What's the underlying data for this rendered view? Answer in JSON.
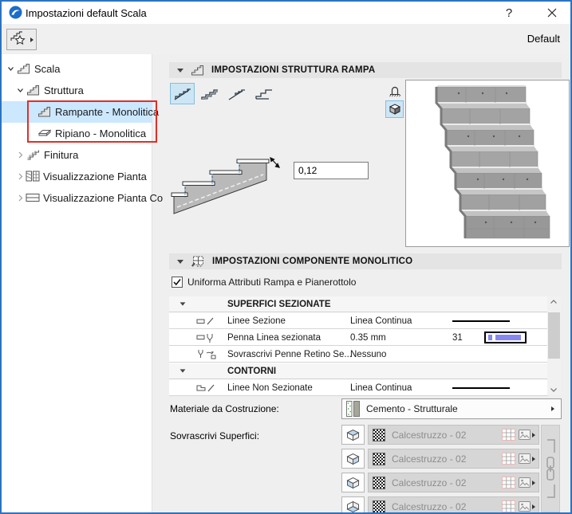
{
  "window": {
    "title": "Impostazioni default Scala",
    "help_label": "?"
  },
  "toolbar": {
    "default_label": "Default"
  },
  "sidebar": {
    "items": [
      {
        "label": "Scala"
      },
      {
        "label": "Struttura"
      },
      {
        "label": "Rampante - Monolitica"
      },
      {
        "label": "Ripiano - Monolitica"
      },
      {
        "label": "Finitura"
      },
      {
        "label": "Visualizzazione Pianta"
      },
      {
        "label": "Visualizzazione Pianta Co"
      }
    ]
  },
  "structure_panel": {
    "title": "IMPOSTAZIONI STRUTTURA RAMPA",
    "thickness_value": "0,12"
  },
  "component_panel": {
    "title": "IMPOSTAZIONI COMPONENTE MONOLITICO",
    "uniform_label": "Uniforma Attributi Rampa e Pianerottolo",
    "table": {
      "group1_header": "SUPERFICI SEZIONATE",
      "row1": {
        "label": "Linee Sezione",
        "value": "Linea Continua"
      },
      "row2": {
        "label": "Penna Linea sezionata",
        "value": "0.35 mm",
        "pen": "31"
      },
      "row3": {
        "label": "Sovrascrivi Penne Retino Se...",
        "value": "Nessuno"
      },
      "group2_header": "CONTORNI",
      "row4": {
        "label": "Linee Non Sezionate",
        "value": "Linea Continua"
      }
    },
    "material_label": "Materiale da Costruzione:",
    "material_value": "Cemento - Strutturale",
    "surfaces_label": "Sovrascrivi Superfici:",
    "surface1": "Calcestruzzo - 02",
    "surface2": "Calcestruzzo - 02",
    "surface3": "Calcestruzzo - 02",
    "surface4": "Calcestruzzo - 02"
  },
  "colors": {
    "window_border": "#2b73c3",
    "tree_selection": "#cce8ff",
    "button_selected": "#cde6f5",
    "annotation_red": "#e12f26",
    "pen_preview": "#8787f0"
  }
}
